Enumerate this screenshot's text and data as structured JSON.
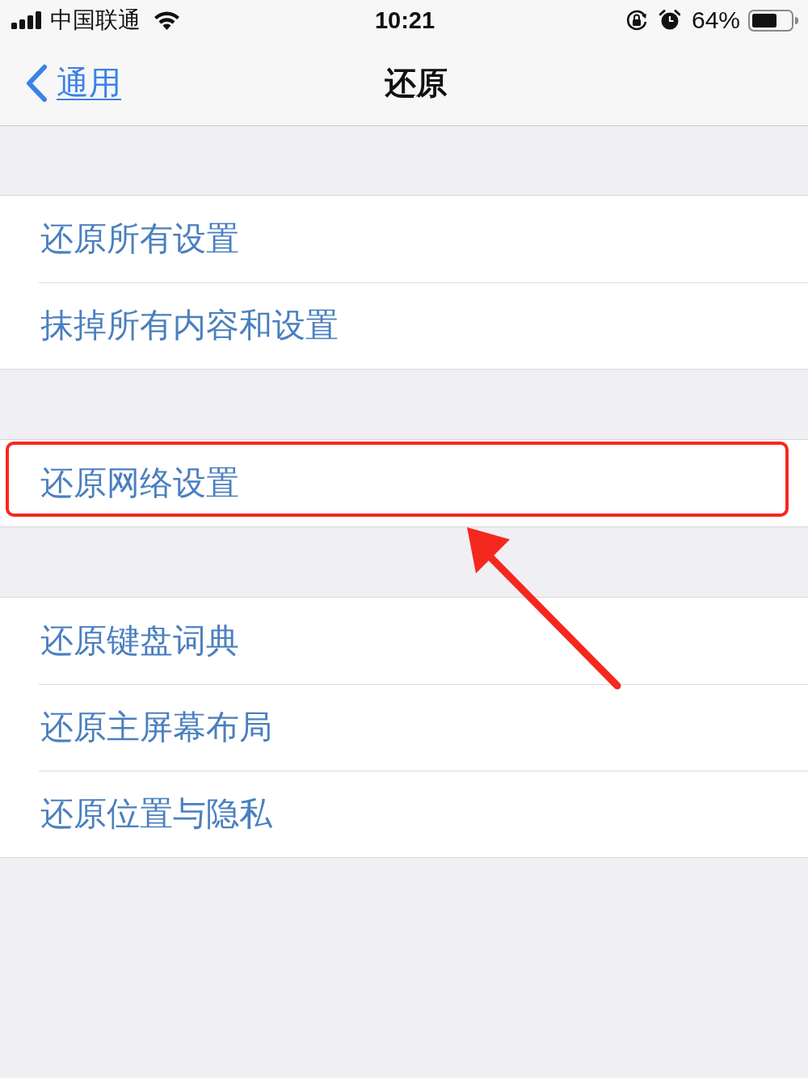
{
  "status_bar": {
    "carrier": "中国联通",
    "time": "10:21",
    "battery": "64%"
  },
  "nav_bar": {
    "back": "通用",
    "title": "还原"
  },
  "groups": [
    {
      "items": [
        {
          "label": "还原所有设置",
          "highlighted": false
        },
        {
          "label": "抹掉所有内容和设置",
          "highlighted": false
        }
      ]
    },
    {
      "items": [
        {
          "label": "还原网络设置",
          "highlighted": true
        }
      ]
    },
    {
      "items": [
        {
          "label": "还原键盘词典",
          "highlighted": false
        },
        {
          "label": "还原主屏幕布局",
          "highlighted": false
        },
        {
          "label": "还原位置与隐私",
          "highlighted": false
        }
      ]
    }
  ]
}
